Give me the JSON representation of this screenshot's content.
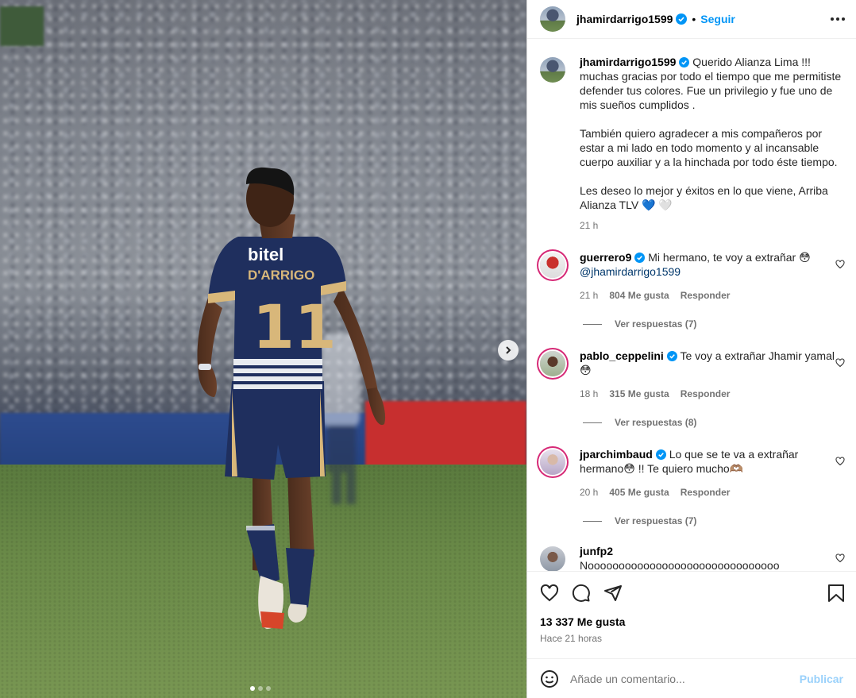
{
  "post": {
    "author": "jhamirdarrigo1599",
    "follow_label": "Seguir",
    "separator": "•",
    "caption": "Querido Alianza Lima !!! muchas gracias por todo el tiempo que me permitiste defender tus colores. Fue un privilegio y fue uno de mis sueños cumplidos .\n\nTambién quiero agradecer a mis compañeros por estar a mi lado en todo momento y al incansable cuerpo auxiliar y a la hinchada por todo éste tiempo.\n\nLes deseo lo mejor y éxitos en lo que viene, Arriba Alianza TLV 💙 🤍",
    "caption_time": "21 h",
    "jersey_sponsor": "bitel",
    "jersey_name": "D'ARRIGO",
    "jersey_number": "11",
    "carousel": {
      "count": 3,
      "active": 0
    },
    "likes": "13 337 Me gusta",
    "posted": "Hace 21 horas"
  },
  "comments": [
    {
      "user": "guerrero9",
      "verified": true,
      "text": "Mi hermano, te voy a extrañar 😳",
      "mention": "@jhamirdarrigo1599",
      "time": "21 h",
      "likes": "804 Me gusta",
      "reply_label": "Responder",
      "replies": "Ver respuestas (7)"
    },
    {
      "user": "pablo_ceppelini",
      "verified": true,
      "text": "Te voy a extrañar Jhamir yamal 😳",
      "time": "18 h",
      "likes": "315 Me gusta",
      "reply_label": "Responder",
      "replies": "Ver respuestas (8)"
    },
    {
      "user": "jparchimbaud",
      "verified": true,
      "text": "Lo que se te va a extrañar hermano😳 !! Te quiero mucho🫶🏽",
      "time": "20 h",
      "likes": "405 Me gusta",
      "reply_label": "Responder",
      "replies": "Ver respuestas (7)"
    },
    {
      "user": "junfp2",
      "verified": false,
      "text": "Nooooooooooooooooooooooooooooooo"
    }
  ],
  "composer": {
    "placeholder": "Añade un comentario...",
    "publish": "Publicar"
  },
  "colors": {
    "accent": "#0095f6",
    "publish_disabled": "#9ad1fb",
    "verified": "#0095f6",
    "jersey": "#1f2f5e",
    "gold": "#d8b77a"
  },
  "icons": [
    "more-icon",
    "verified-icon",
    "heart-icon",
    "comment-icon",
    "share-icon",
    "bookmark-icon",
    "emoji-icon",
    "chevron-right-icon"
  ]
}
